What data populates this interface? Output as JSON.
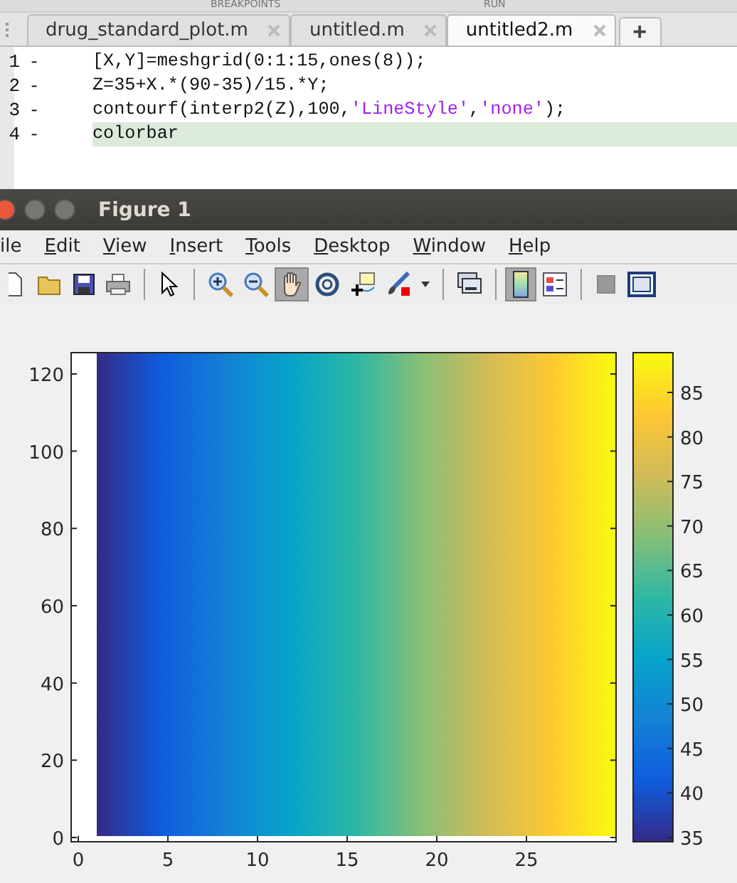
{
  "editor": {
    "toolstrip_labels": [
      "BREAKPOINTS",
      "RUN"
    ],
    "tabs": [
      {
        "label": "drug_standard_plot.m",
        "selected": false
      },
      {
        "label": "untitled.m",
        "selected": false
      },
      {
        "label": "untitled2.m",
        "selected": true
      }
    ],
    "new_tab": "+",
    "lines": [
      {
        "number": "1",
        "marker": "-",
        "current": false,
        "segments": [
          {
            "kind": "code",
            "text": "[X,Y]=meshgrid(0:1:15,ones(8));"
          }
        ]
      },
      {
        "number": "2",
        "marker": "-",
        "current": false,
        "segments": [
          {
            "kind": "code",
            "text": "Z=35+X.*(90-35)/15.*Y;"
          }
        ]
      },
      {
        "number": "3",
        "marker": "-",
        "current": false,
        "segments": [
          {
            "kind": "code",
            "text": "contourf(interp2(Z),100,"
          },
          {
            "kind": "string",
            "text": "'LineStyle'"
          },
          {
            "kind": "code",
            "text": ","
          },
          {
            "kind": "string",
            "text": "'none'"
          },
          {
            "kind": "code",
            "text": ");"
          }
        ]
      },
      {
        "number": "4",
        "marker": "-",
        "current": true,
        "segments": [
          {
            "kind": "code",
            "text": "colorbar"
          }
        ]
      }
    ]
  },
  "figure": {
    "title": "Figure 1",
    "menus": [
      {
        "label": "ile",
        "mnemonic": false
      },
      {
        "label": "Edit",
        "mnemonic": true
      },
      {
        "label": "View",
        "mnemonic": true
      },
      {
        "label": "Insert",
        "mnemonic": true
      },
      {
        "label": "Tools",
        "mnemonic": true
      },
      {
        "label": "Desktop",
        "mnemonic": true
      },
      {
        "label": "Window",
        "mnemonic": true
      },
      {
        "label": "Help",
        "mnemonic": true
      }
    ],
    "toolbar": [
      {
        "kind": "new"
      },
      {
        "kind": "open"
      },
      {
        "kind": "save"
      },
      {
        "kind": "print"
      },
      {
        "kind": "sep"
      },
      {
        "kind": "pointer",
        "on": false
      },
      {
        "kind": "sep"
      },
      {
        "kind": "zoomin",
        "on": false
      },
      {
        "kind": "zoomout",
        "on": false
      },
      {
        "kind": "pan",
        "on": true
      },
      {
        "kind": "rotate",
        "on": false
      },
      {
        "kind": "cursor",
        "on": false
      },
      {
        "kind": "brush",
        "on": false
      },
      {
        "kind": "caret"
      },
      {
        "kind": "sep"
      },
      {
        "kind": "link"
      },
      {
        "kind": "sep"
      },
      {
        "kind": "colorbar",
        "on": true
      },
      {
        "kind": "legend",
        "on": false
      },
      {
        "kind": "sep"
      },
      {
        "kind": "square"
      },
      {
        "kind": "frame"
      }
    ],
    "axes": {
      "yticks": [
        "120",
        "100",
        "80",
        "60",
        "40",
        "20",
        "0"
      ],
      "xticks": [
        "0",
        "5",
        "10",
        "15",
        "20",
        "25"
      ]
    },
    "colorbar": {
      "ticks": [
        "85",
        "80",
        "75",
        "70",
        "65",
        "60",
        "55",
        "50",
        "45",
        "40",
        "35"
      ]
    }
  }
}
